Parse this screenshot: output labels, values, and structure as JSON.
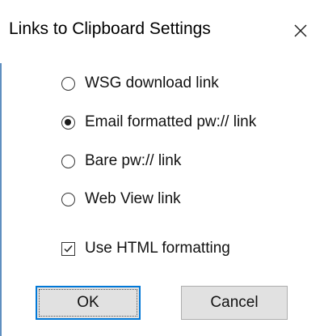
{
  "dialog": {
    "title": "Links to Clipboard Settings",
    "close_icon": "close-icon",
    "options": [
      {
        "label": "WSG download link",
        "selected": false
      },
      {
        "label": "Email formatted pw:// link",
        "selected": true
      },
      {
        "label": "Bare pw:// link",
        "selected": false
      },
      {
        "label": "Web View link",
        "selected": false
      }
    ],
    "html_formatting": {
      "label": "Use HTML formatting",
      "checked": true
    },
    "buttons": {
      "ok_label": "OK",
      "cancel_label": "Cancel"
    }
  }
}
